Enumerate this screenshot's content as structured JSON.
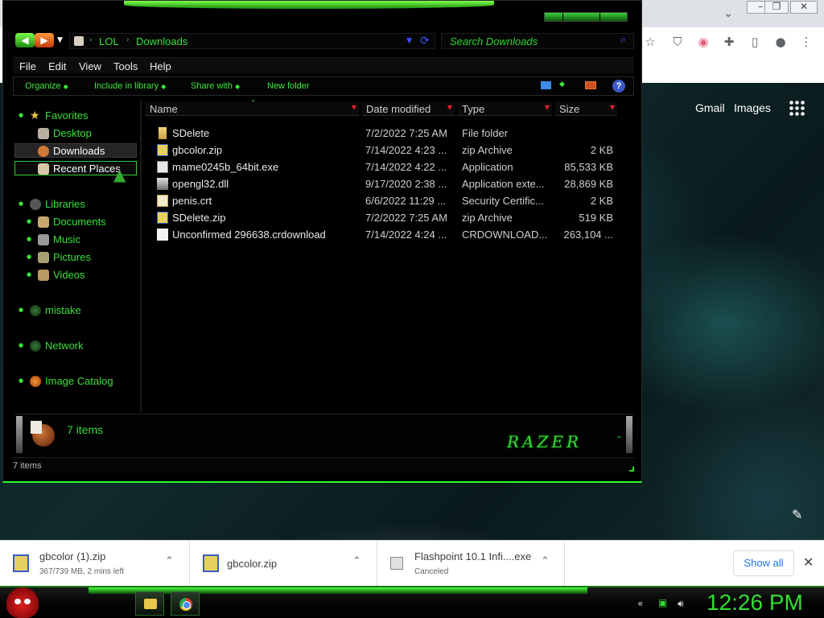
{
  "browser": {
    "links": [
      "Gmail",
      "Images"
    ],
    "window_controls": [
      "minimize",
      "restore",
      "close"
    ]
  },
  "explorer": {
    "breadcrumbs": [
      "LOL",
      "Downloads"
    ],
    "search_placeholder": "Search Downloads",
    "menu": [
      "File",
      "Edit",
      "View",
      "Tools",
      "Help"
    ],
    "commands": [
      "Organize",
      "Include in library",
      "Share with",
      "New folder"
    ],
    "nav": {
      "favorites": "Favorites",
      "desktop": "Desktop",
      "downloads": "Downloads",
      "recent": "Recent Places",
      "libraries": "Libraries",
      "documents": "Documents",
      "music": "Music",
      "pictures": "Pictures",
      "videos": "Videos",
      "mistake": "mistake",
      "network": "Network",
      "image_catalog": "Image Catalog"
    },
    "columns": [
      "Name",
      "Date modified",
      "Type",
      "Size"
    ],
    "files": [
      {
        "name": "SDelete",
        "date": "7/2/2022 7:25 AM",
        "type": "File folder",
        "size": "",
        "icon": "folder-icon"
      },
      {
        "name": "gbcolor.zip",
        "date": "7/14/2022 4:23 ...",
        "type": "zip Archive",
        "size": "2 KB",
        "icon": "zip-icon"
      },
      {
        "name": "mame0245b_64bit.exe",
        "date": "7/14/2022 4:22 ...",
        "type": "Application",
        "size": "85,533 KB",
        "icon": "exe-icon"
      },
      {
        "name": "opengl32.dll",
        "date": "9/17/2020 2:38 ...",
        "type": "Application exte...",
        "size": "28,869 KB",
        "icon": "dll-icon"
      },
      {
        "name": "penis.crt",
        "date": "6/6/2022 11:29 ...",
        "type": "Security Certific...",
        "size": "2 KB",
        "icon": "certificate-icon"
      },
      {
        "name": "SDelete.zip",
        "date": "7/2/2022 7:25 AM",
        "type": "zip Archive",
        "size": "519 KB",
        "icon": "zip-icon"
      },
      {
        "name": "Unconfirmed 296638.crdownload",
        "date": "7/14/2022 4:24 ...",
        "type": "CRDOWNLOAD...",
        "size": "263,104 ...",
        "icon": "file-icon"
      }
    ],
    "details_count": "7 items",
    "brand": "RAZER",
    "status_text": "7 items"
  },
  "downloads": [
    {
      "name": "gbcolor (1).zip",
      "status": "367/739 MB, 2 mins left"
    },
    {
      "name": "gbcolor.zip",
      "status": ""
    },
    {
      "name": "Flashpoint 10.1 Infi....exe",
      "status": "Canceled"
    }
  ],
  "show_all_label": "Show all",
  "taskbar": {
    "clock": "12:26 PM"
  },
  "colors": {
    "accent_green": "#33dd33",
    "explorer_bg": "#000000",
    "link_blue": "#1a73e8"
  }
}
